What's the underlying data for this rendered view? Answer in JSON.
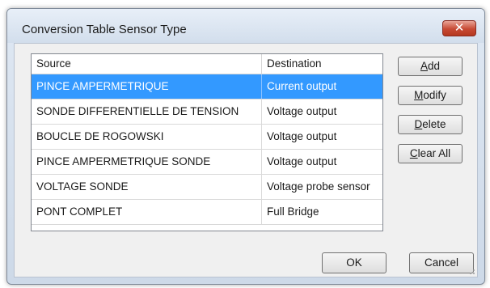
{
  "window": {
    "title": "Conversion Table Sensor Type",
    "close_icon": "✕"
  },
  "table": {
    "columns": [
      "Source",
      "Destination"
    ],
    "selected_index": 0,
    "rows": [
      {
        "source": "PINCE AMPERMETRIQUE",
        "destination": "Current output"
      },
      {
        "source": "SONDE DIFFERENTIELLE DE TENSION",
        "destination": "Voltage output"
      },
      {
        "source": "BOUCLE DE ROGOWSKI",
        "destination": "Voltage output"
      },
      {
        "source": "PINCE AMPERMETRIQUE SONDE",
        "destination": "Voltage output"
      },
      {
        "source": "VOLTAGE SONDE",
        "destination": "Voltage probe sensor"
      },
      {
        "source": "PONT COMPLET",
        "destination": "Full Bridge"
      }
    ]
  },
  "buttons": {
    "add": {
      "first": "A",
      "rest": "dd"
    },
    "modify": {
      "first": "M",
      "rest": "odify"
    },
    "delete": {
      "first": "D",
      "rest": "elete"
    },
    "clear_all": {
      "first": "C",
      "rest": "lear All"
    },
    "ok": "OK",
    "cancel": "Cancel"
  },
  "colors": {
    "selection": "#3399ff",
    "close_button": "#c74a34"
  }
}
